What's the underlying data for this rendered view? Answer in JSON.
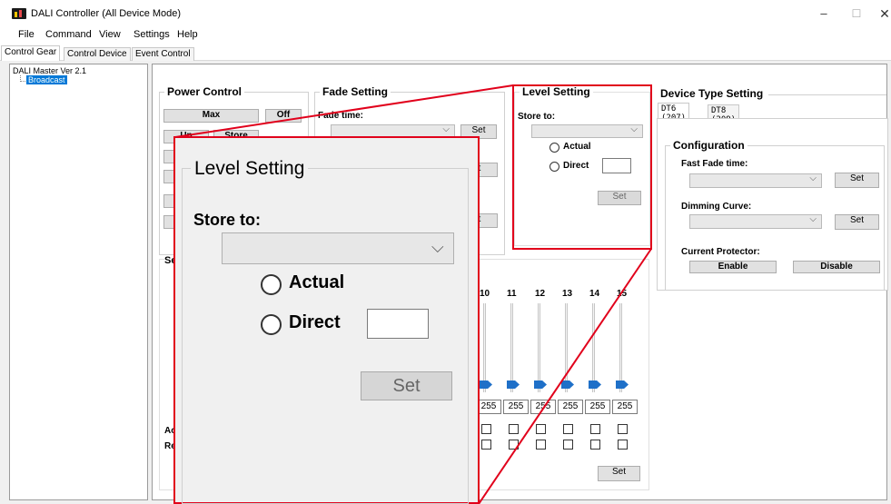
{
  "window": {
    "title": "DALI Controller (All Device Mode)",
    "minimize_glyph": "–",
    "maximize_glyph": "☐",
    "close_glyph": "✕"
  },
  "menu": {
    "items": [
      {
        "label": "File"
      },
      {
        "label": "Command"
      },
      {
        "label": "View"
      },
      {
        "label": "Settings"
      },
      {
        "label": "Help"
      }
    ]
  },
  "tabs": [
    {
      "label": "Control Gear"
    },
    {
      "label": "Control Device"
    },
    {
      "label": "Event Control"
    }
  ],
  "tree": {
    "root": "DALI Master Ver 2.1",
    "child": "Broadcast"
  },
  "power_control": {
    "title": "Power Control",
    "max_label": "Max",
    "off_label": "Off",
    "up_label": "Up",
    "store_label": "Store"
  },
  "fade_setting": {
    "title": "Fade Setting",
    "fade_time_label": "Fade time:",
    "set_label": "Set",
    "set_label_partial": "et"
  },
  "level_setting": {
    "title": "Level Setting",
    "store_to_label": "Store to:",
    "actual_label": "Actual",
    "direct_label": "Direct",
    "set_label": "Set"
  },
  "device_type_setting": {
    "title": "Device Type Setting",
    "tabs": [
      {
        "label": "DT6 (207)"
      },
      {
        "label": "DT8 (209)"
      }
    ],
    "configuration": {
      "title": "Configuration",
      "fast_fade_label": "Fast Fade time:",
      "dimming_curve_label": "Dimming Curve:",
      "current_protector_label": "Current Protector:",
      "set_label": "Set",
      "enable_label": "Enable",
      "disable_label": "Disable"
    }
  },
  "channels": {
    "numbers": [
      "10",
      "11",
      "12",
      "13",
      "14",
      "15"
    ],
    "values": [
      "255",
      "255",
      "255",
      "255",
      "255",
      "255"
    ],
    "set_label": "Set",
    "row_labels": [
      "Ac",
      "Re"
    ],
    "section_label": "Se"
  },
  "colors": {
    "callout_red": "#e1001b",
    "slider_thumb_blue": "#1f70c8",
    "selection_blue": "#0078d7"
  }
}
